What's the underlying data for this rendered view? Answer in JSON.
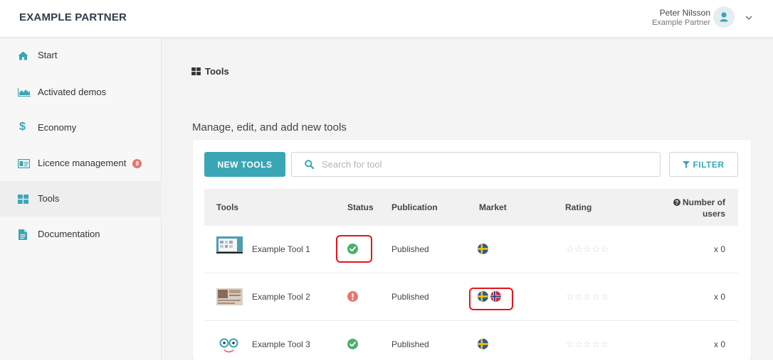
{
  "header": {
    "brand": "EXAMPLE PARTNER",
    "user_name": "Peter Nilsson",
    "user_company": "Example Partner",
    "avatar_icon": "user-icon",
    "menu_icon": "chevron-down-icon"
  },
  "sidebar": {
    "items": [
      {
        "label": "Start",
        "icon": "home-icon"
      },
      {
        "label": "Activated demos",
        "icon": "area-chart-icon"
      },
      {
        "label": "Economy",
        "icon": "dollar-icon"
      },
      {
        "label": "Licence management",
        "icon": "id-card-icon",
        "badge": "8"
      },
      {
        "label": "Tools",
        "icon": "grid-icon",
        "active": true
      },
      {
        "label": "Documentation",
        "icon": "document-icon"
      }
    ]
  },
  "breadcrumb": {
    "label": "Tools",
    "icon": "grid-icon"
  },
  "main": {
    "subtitle": "Manage, edit, and add new tools",
    "new_button": "NEW TOOLS",
    "search_placeholder": "Search for tool",
    "filter_button": "FILTER"
  },
  "table": {
    "headers": {
      "tools": "Tools",
      "status": "Status",
      "publication": "Publication",
      "market": "Market",
      "rating": "Rating",
      "users_line1": "Number of",
      "users_line2": "users"
    },
    "rows": [
      {
        "name": "Example Tool 1",
        "status": "ok",
        "publication": "Published",
        "markets": [
          "sweden"
        ],
        "rating": "☆☆☆☆☆",
        "rating_value": 0,
        "users": "x 0"
      },
      {
        "name": "Example Tool 2",
        "status": "error",
        "publication": "Published",
        "markets": [
          "sweden",
          "norway"
        ],
        "rating": "☆☆☆☆☆",
        "rating_value": 0,
        "users": "x 0"
      },
      {
        "name": "Example Tool 3",
        "status": "ok",
        "publication": "Published",
        "markets": [
          "sweden"
        ],
        "rating": "☆☆☆☆☆",
        "rating_value": 0,
        "users": "x 0"
      }
    ]
  },
  "colors": {
    "accent": "#3aa6b5",
    "status_ok": "#4caf6e",
    "status_error": "#e8766f",
    "badge": "#e8766f",
    "highlight": "#e5141c"
  }
}
